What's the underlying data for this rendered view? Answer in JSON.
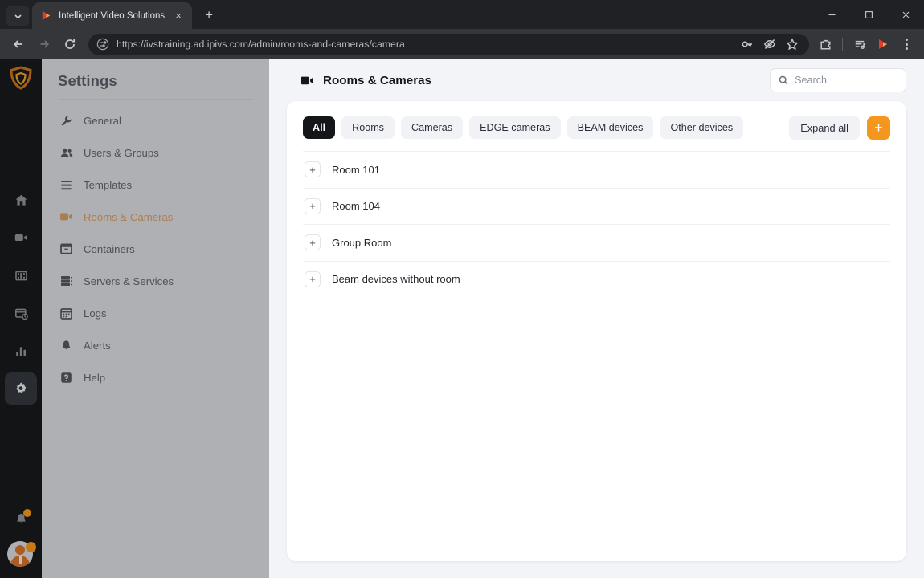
{
  "browser": {
    "tab": {
      "title": "Intelligent Video Solutions",
      "favicon": "play-triangle-icon",
      "close": "×"
    },
    "tab_list_icon": "chevron-down-icon",
    "new_tab_label": "+",
    "window_controls": {
      "minimize": "minimize-icon",
      "maximize": "maximize-icon",
      "close": "close-icon"
    },
    "nav": {
      "back": "back-arrow-icon",
      "forward": "forward-arrow-icon",
      "reload": "reload-icon"
    },
    "omnibox": {
      "url": "https://ivstraining.ad.ipivs.com/admin/rooms-and-cameras/camera",
      "site_settings_icon": "tune-sliders-icon",
      "actions": [
        "key-icon",
        "eye-slash-icon",
        "star-icon"
      ]
    },
    "toolbar_right": [
      "extensions-puzzle-icon",
      "reading-list-icon",
      "profile-avatar-icon",
      "menu-dots-icon"
    ]
  },
  "rail": {
    "logo": "shield-logo-icon",
    "items": [
      {
        "name": "home-icon",
        "active": false
      },
      {
        "name": "video-camera-icon",
        "active": false
      },
      {
        "name": "film-strip-icon",
        "active": false
      },
      {
        "name": "server-clock-icon",
        "active": false
      },
      {
        "name": "bar-chart-icon",
        "active": false
      },
      {
        "name": "gear-icon",
        "active": true
      }
    ],
    "bottom": {
      "bell": "bell-icon",
      "bell_badge": true,
      "avatar": "user-avatar-icon",
      "avatar_badge": true
    }
  },
  "sidebar": {
    "title": "Settings",
    "items": [
      {
        "label": "General",
        "icon": "wrench-icon",
        "active": false
      },
      {
        "label": "Users & Groups",
        "icon": "users-icon",
        "active": false
      },
      {
        "label": "Templates",
        "icon": "list-icon",
        "active": false
      },
      {
        "label": "Rooms & Cameras",
        "icon": "video-camera-icon",
        "active": true
      },
      {
        "label": "Containers",
        "icon": "box-icon",
        "active": false
      },
      {
        "label": "Servers & Services",
        "icon": "server-icon",
        "active": false
      },
      {
        "label": "Logs",
        "icon": "calendar-icon",
        "active": false
      },
      {
        "label": "Alerts",
        "icon": "alert-bell-icon",
        "active": false
      },
      {
        "label": "Help",
        "icon": "help-icon",
        "active": false
      }
    ]
  },
  "main": {
    "page_title": "Rooms & Cameras",
    "page_icon": "video-camera-icon",
    "search": {
      "placeholder": "Search",
      "value": "",
      "icon": "search-icon"
    },
    "filters": [
      {
        "label": "All",
        "active": true
      },
      {
        "label": "Rooms",
        "active": false
      },
      {
        "label": "Cameras",
        "active": false
      },
      {
        "label": "EDGE cameras",
        "active": false
      },
      {
        "label": "BEAM devices",
        "active": false
      },
      {
        "label": "Other devices",
        "active": false
      }
    ],
    "expand_all_label": "Expand all",
    "add_label": "+",
    "rows": [
      {
        "label": "Room 101",
        "toggle": "+"
      },
      {
        "label": "Room 104",
        "toggle": "+"
      },
      {
        "label": "Group Room",
        "toggle": "+"
      },
      {
        "label": "Beam devices without room",
        "toggle": "+"
      }
    ]
  },
  "colors": {
    "accent_orange": "#f5971f",
    "active_nav_orange": "#f79020",
    "chip_active_bg": "#14161a",
    "app_bg": "#f3f4f8",
    "rail_bg": "#18191b"
  }
}
